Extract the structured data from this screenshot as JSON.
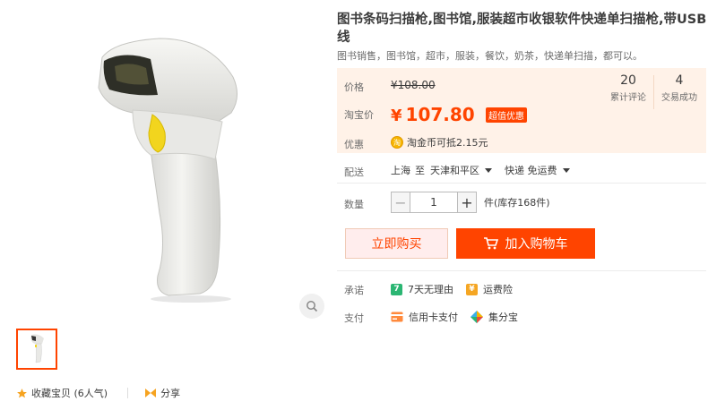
{
  "product": {
    "title": "图书条码扫描枪,图书馆,服装超市收银软件快递单扫描枪,带USB线",
    "subtitle": "图书销售，图书馆，超市，服装，餐饮，奶茶，快递单扫描，都可以。"
  },
  "price": {
    "label": "价格",
    "original": "¥108.00",
    "taobao_label": "淘宝价",
    "currency": "¥",
    "current": "107.80",
    "tag": "超值优惠"
  },
  "stats": [
    {
      "value": "20",
      "label": "累计评论"
    },
    {
      "value": "4",
      "label": "交易成功"
    }
  ],
  "promo": {
    "label": "优惠",
    "icon_text": "淘",
    "text": "淘金币可抵2.15元"
  },
  "shipping": {
    "label": "配送",
    "from": "上海",
    "to_word": "至",
    "destination": "天津和平区",
    "method": "快递 免运费"
  },
  "quantity": {
    "label": "数量",
    "minus": "−",
    "value": "1",
    "plus": "+",
    "unit": "件(库存168件)"
  },
  "actions": {
    "buy_now": "立即购买",
    "add_to_cart": "加入购物车"
  },
  "commitment": {
    "label": "承诺",
    "items": [
      {
        "icon_text": "7",
        "text": "7天无理由"
      },
      {
        "icon_text": "¥",
        "text": "运费险"
      }
    ]
  },
  "payment": {
    "label": "支付",
    "items": [
      {
        "text": "信用卡支付"
      },
      {
        "text": "集分宝"
      }
    ]
  },
  "social": {
    "favorite": "收藏宝贝 (6人气)",
    "share": "分享"
  },
  "colors": {
    "accent": "#ff4400",
    "price_bg": "#fff2e8"
  }
}
